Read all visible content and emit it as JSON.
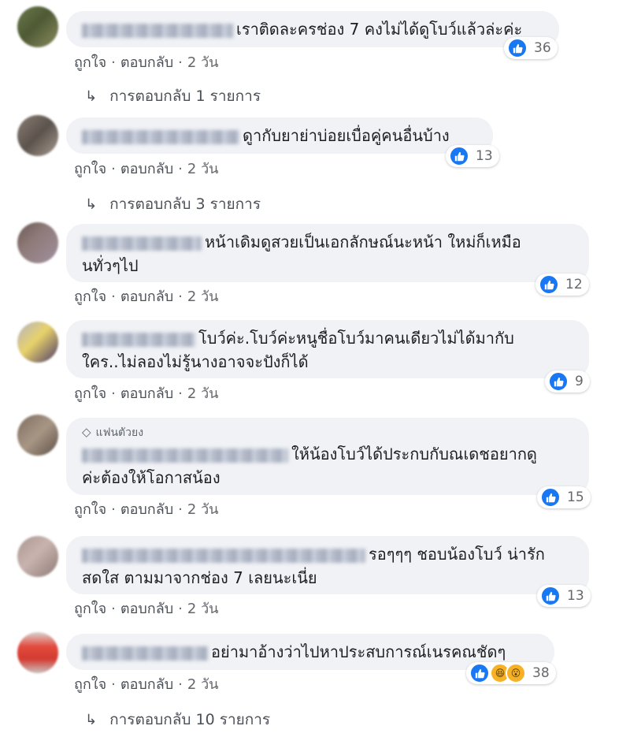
{
  "labels": {
    "like": "ถูกใจ",
    "reply": "ตอบกลับ",
    "dot": "·"
  },
  "comments": [
    {
      "text": "เราติดละครช่อง 7 คงไม่ได้ดูโบว์แล้วล่ะค่ะ",
      "time": "2 วัน",
      "reactions": "36",
      "replies": "การตอบกลับ 1 รายการ"
    },
    {
      "text": "ดูากับยาย่าบ่อยเบื่อคู่คนอื่นบ้าง",
      "time": "2 วัน",
      "reactions": "13",
      "replies": "การตอบกลับ 3 รายการ"
    },
    {
      "line1": "หน้าเดิมดูสวยเป็นเอกลักษณ์นะหน้า ใหม่ก็เหมือ",
      "line2": "นทั่วๆไป",
      "time": "2 วัน",
      "reactions": "12"
    },
    {
      "line1": "โบว์ค่ะ.โบว์ค่ะหนูชื่อโบว์มาคนเดียวไม่ได้มากับ",
      "line2": "ใคร..ไม่ลองไม่รู้นางอาจจะปังก็ได้",
      "time": "2 วัน",
      "reactions": "9"
    },
    {
      "badge": "แฟนตัวยง",
      "line1": "ให้น้องโบว์ได้ประกบกับณเดชอยากดู",
      "line2": "ค่ะต้องให้โอกาสน้อง",
      "time": "2 วัน",
      "reactions": "15"
    },
    {
      "line1": "รอๆๆๆ ชอบน้องโบว์ น่ารัก",
      "line2": "สดใส ตามมาจากช่อง 7 เลยนะเนี่ย",
      "time": "2 วัน",
      "reactions": "13"
    },
    {
      "text": "อย่ามาอ้างว่าไปหาประสบการณ์เนรคณชัดๆ",
      "time": "2 วัน",
      "reactions": "38",
      "replies": "การตอบกลับ 10 รายการ"
    }
  ],
  "icons": {
    "like": "like-icon",
    "haha": "haha-icon",
    "wow": "wow-icon",
    "reply_arrow": "reply-arrow-icon",
    "diamond": "diamond-icon"
  },
  "colors": {
    "accent": "#1877f2",
    "bubble": "#f0f2f5",
    "secondary_text": "#65676b"
  }
}
